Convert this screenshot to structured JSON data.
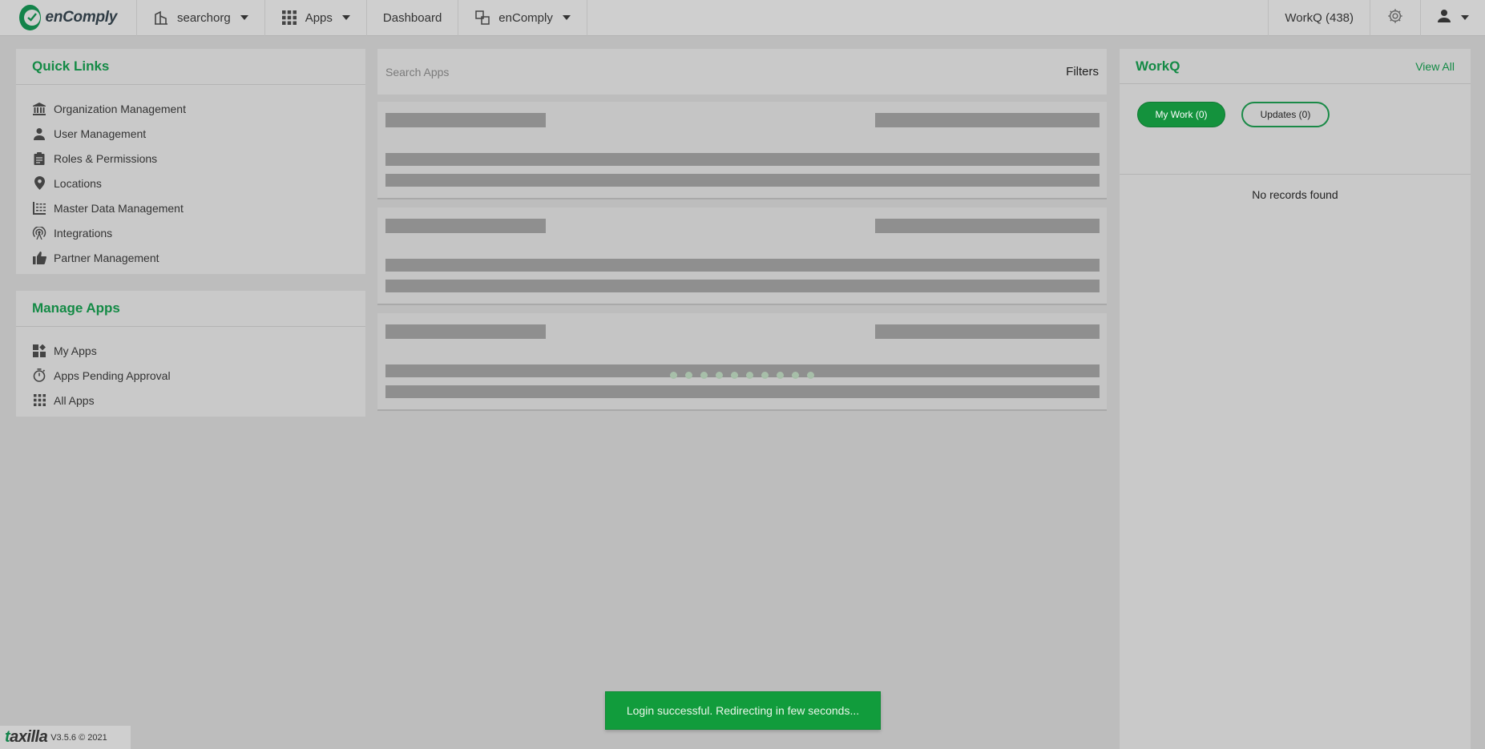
{
  "brand": {
    "name": "enComply",
    "accent": "#138a45"
  },
  "nav": {
    "org": {
      "label": "searchorg",
      "icon": "building-icon"
    },
    "apps": {
      "label": "Apps",
      "icon": "grid-icon"
    },
    "dashboard": {
      "label": "Dashboard"
    },
    "app_switch": {
      "label": "enComply",
      "icon": "switch-app-icon"
    },
    "workq": {
      "label": "WorkQ (438)"
    },
    "settings": {
      "icon": "gear-icon"
    },
    "user": {
      "icon": "user-icon"
    }
  },
  "quick_links": {
    "title": "Quick Links",
    "items": [
      {
        "label": "Organization Management",
        "icon": "bank-icon"
      },
      {
        "label": "User Management",
        "icon": "person-icon"
      },
      {
        "label": "Roles & Permissions",
        "icon": "clipboard-icon"
      },
      {
        "label": "Locations",
        "icon": "map-pin-icon"
      },
      {
        "label": "Master Data Management",
        "icon": "data-grid-icon"
      },
      {
        "label": "Integrations",
        "icon": "antenna-icon"
      },
      {
        "label": "Partner Management",
        "icon": "thumbs-up-icon"
      }
    ]
  },
  "manage_apps": {
    "title": "Manage Apps",
    "items": [
      {
        "label": "My Apps",
        "icon": "widgets-icon"
      },
      {
        "label": "Apps Pending Approval",
        "icon": "timer-icon"
      },
      {
        "label": "All Apps",
        "icon": "apps-grid-icon"
      }
    ]
  },
  "search": {
    "placeholder": "Search Apps",
    "filters_label": "Filters"
  },
  "workq_panel": {
    "title": "WorkQ",
    "view_all": "View All",
    "tabs": [
      {
        "label": "My Work (0)",
        "active": true
      },
      {
        "label": "Updates (0)",
        "active": false
      }
    ],
    "empty_text": "No records found"
  },
  "toast": {
    "message": "Login successful. Redirecting in few seconds..."
  },
  "footer": {
    "brand": "taxilla",
    "version": "V3.5.6 © 2021"
  }
}
